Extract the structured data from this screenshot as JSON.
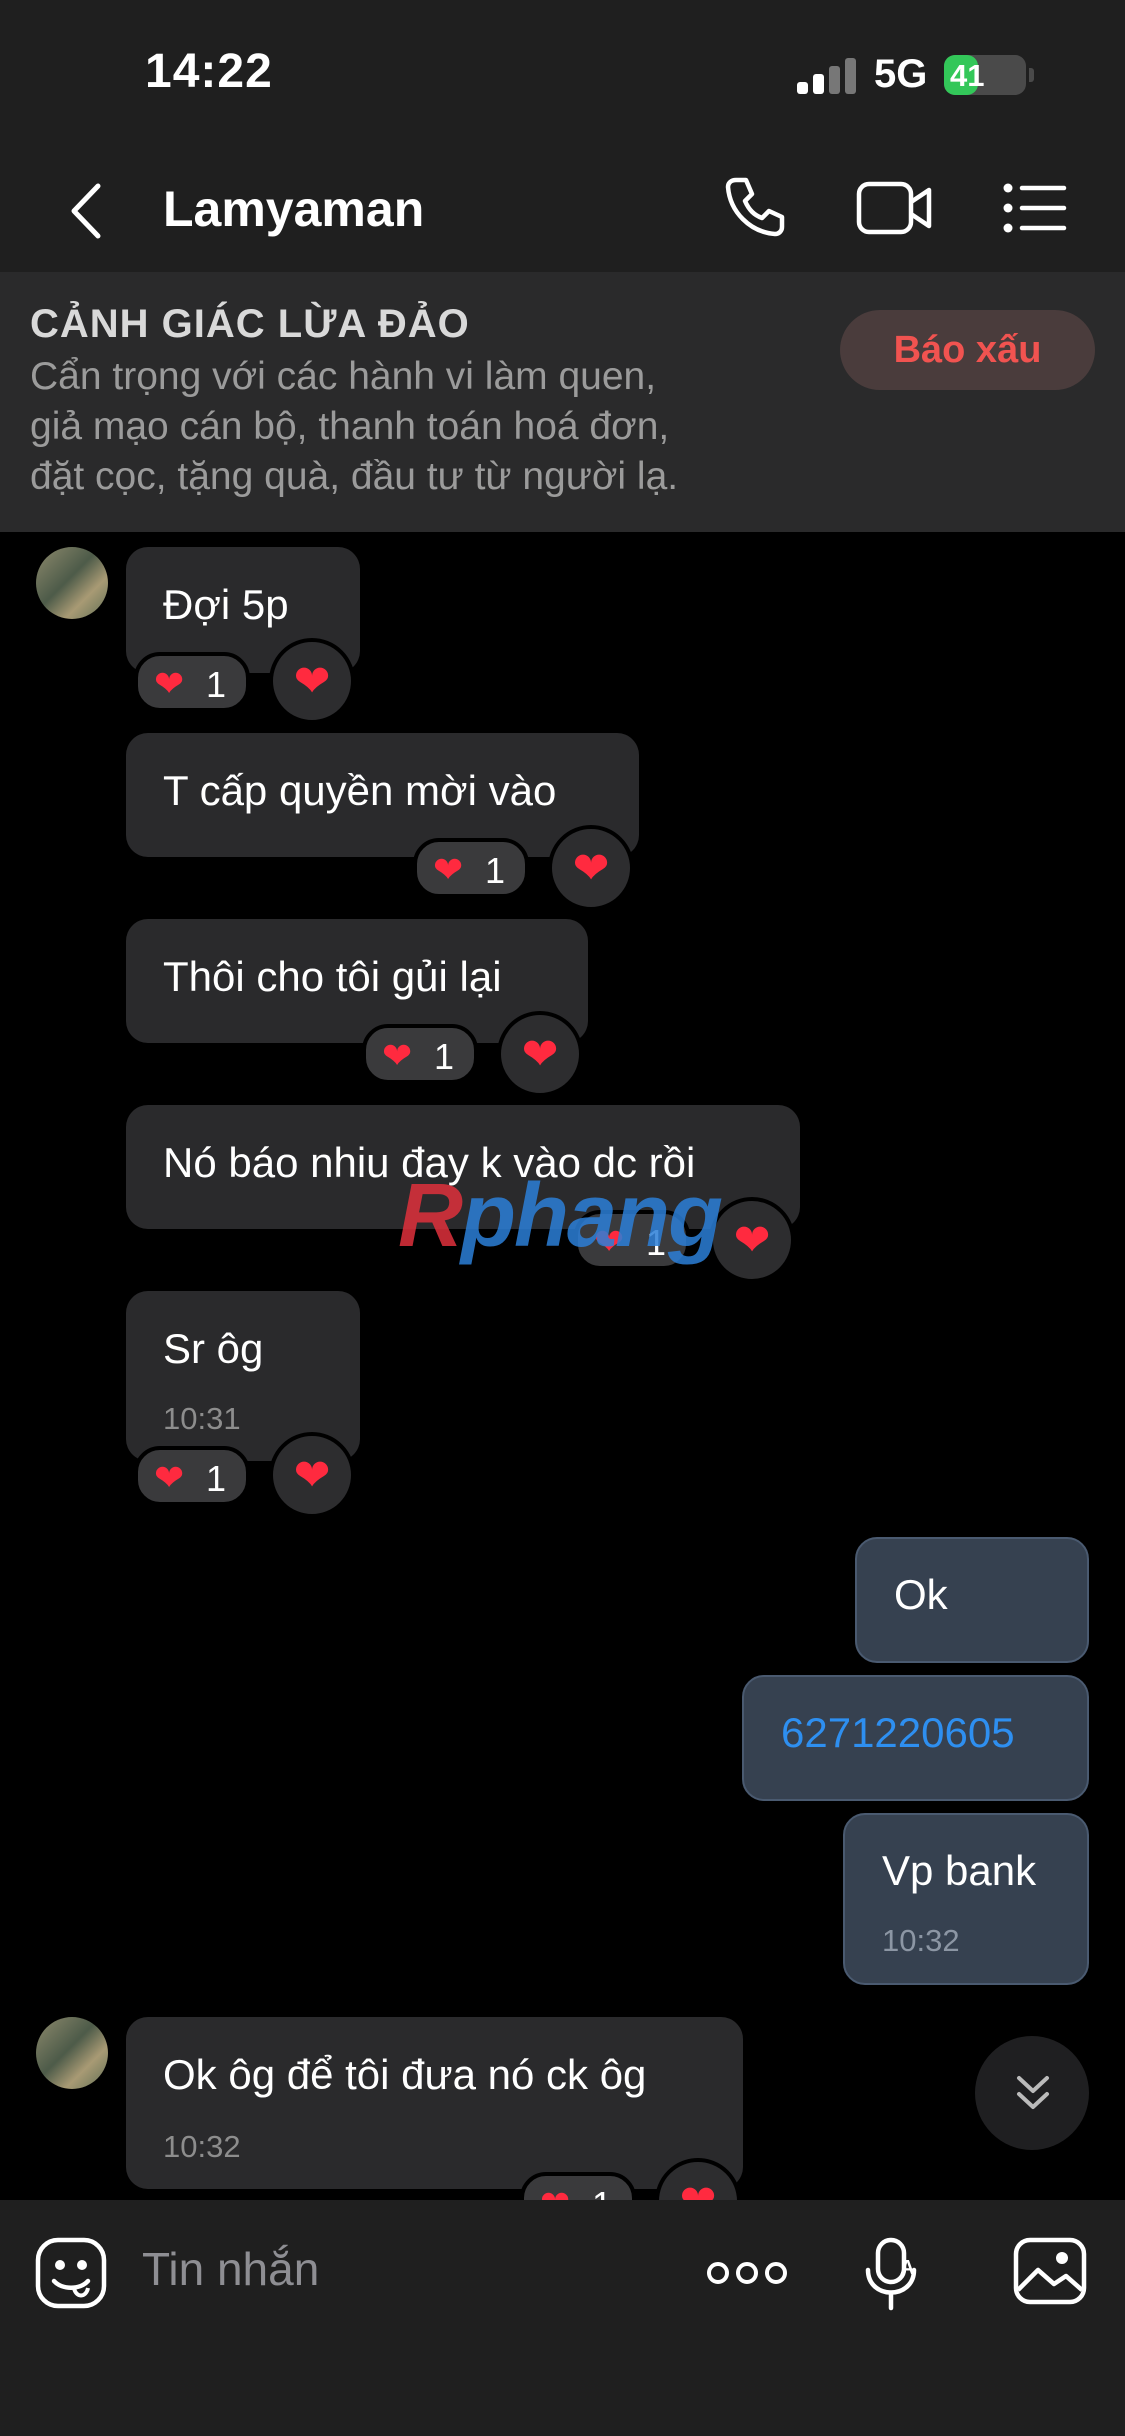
{
  "status": {
    "time": "14:22",
    "network": "5G",
    "battery": "41",
    "battery_level": 0.41
  },
  "header": {
    "back_icon": "chevron-left-icon",
    "title": "Lamyaman",
    "call_icon": "phone-icon",
    "video_icon": "video-camera-icon",
    "menu_icon": "list-icon"
  },
  "banner": {
    "title": "CẢNH GIÁC LỪA ĐẢO",
    "line1": "Cẩn trọng với các hành vi làm quen,",
    "line2": "giả mạo cán bộ, thanh toán hoá đơn,",
    "line3": "đặt cọc, tặng quà, đầu tư từ người lạ.",
    "report": "Báo xấu"
  },
  "messages": [
    {
      "from": "them",
      "text": "Đợi 5p",
      "reaction_count": "1"
    },
    {
      "from": "them",
      "text": "T cấp quyền mời vào",
      "reaction_count": "1"
    },
    {
      "from": "them",
      "text": "Thôi cho tôi gủi lại",
      "reaction_count": "1"
    },
    {
      "from": "them",
      "text": "Nó báo nhiu đay k vào dc rồi",
      "reaction_count": "1"
    },
    {
      "from": "them",
      "text": "Sr ôg",
      "time": "10:31",
      "reaction_count": "1"
    },
    {
      "from": "me",
      "text": "Ok"
    },
    {
      "from": "me",
      "text": "6271220605"
    },
    {
      "from": "me",
      "text": "Vp bank",
      "time": "10:32"
    },
    {
      "from": "them",
      "text": "Ok ôg để tôi đưa nó ck ôg",
      "time": "10:32",
      "reaction_count": "1"
    }
  ],
  "watermark": {
    "first": "R",
    "rest": "phang"
  },
  "input": {
    "placeholder": "Tin nhắn",
    "emoji_icon": "emoji-icon",
    "more_icon": "more-dots-icon",
    "mic_icon": "microphone-icon",
    "image_icon": "image-icon"
  },
  "colors": {
    "link": "#2e8ff0",
    "heart": "#ff2a3f",
    "report": "#f15350",
    "outgoing_bubble": "#364150"
  }
}
